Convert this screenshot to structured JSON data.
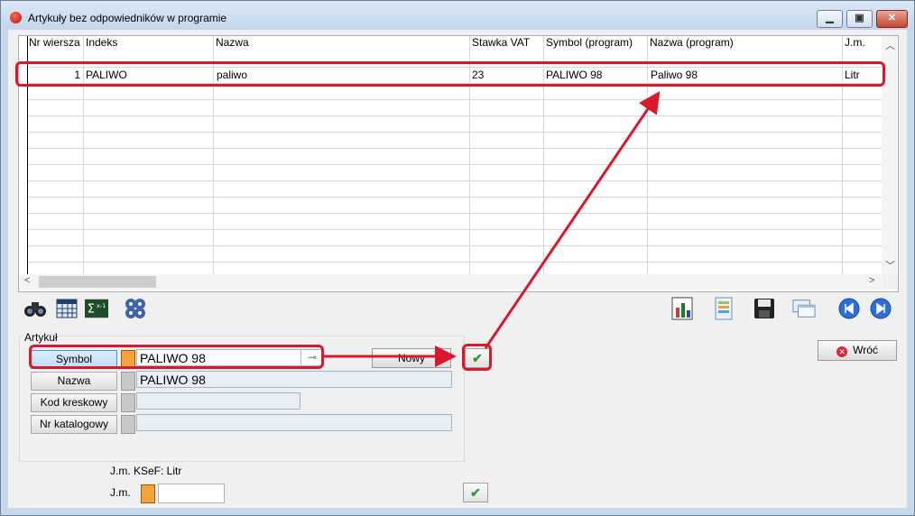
{
  "window": {
    "title": "Artykuły bez odpowiedników w programie"
  },
  "grid": {
    "columns": [
      "Nr wiersza",
      "Indeks",
      "Nazwa",
      "Stawka VAT",
      "Symbol (program)",
      "Nazwa (program)",
      "J.m."
    ],
    "rows": [
      {
        "nr": "1",
        "indeks": "PALIWO",
        "nazwa": "paliwo",
        "vat": "23",
        "symbol_program": "PALIWO 98",
        "nazwa_program": "Paliwo 98",
        "jm": "Litr"
      }
    ]
  },
  "toolbar_left": [
    "binoculars-icon",
    "calendar-grid-icon",
    "sigma-icon",
    "settings-gears-icon"
  ],
  "toolbar_right": [
    "chart-icon",
    "export-icon",
    "save-icon",
    "windows-icon",
    "first-record-icon",
    "last-record-icon"
  ],
  "artykul": {
    "group_label": "Artykuł",
    "symbol_label": "Symbol",
    "symbol_value": "PALIWO 98",
    "nazwa_label": "Nazwa",
    "nazwa_value": "PALIWO 98",
    "kod_label": "Kod kreskowy",
    "kod_value": "",
    "katalog_label": "Nr katalogowy",
    "katalog_value": "",
    "nowy_label": "Nowy",
    "accept_symbol": "✔"
  },
  "wroc_label": "Wróć",
  "jm": {
    "ksef_text": "J.m. KSeF: Litr",
    "label": "J.m.",
    "value": "",
    "accept_symbol": "✔"
  },
  "colors": {
    "highlight": "#d9192b",
    "accept": "#2f9a2f"
  }
}
